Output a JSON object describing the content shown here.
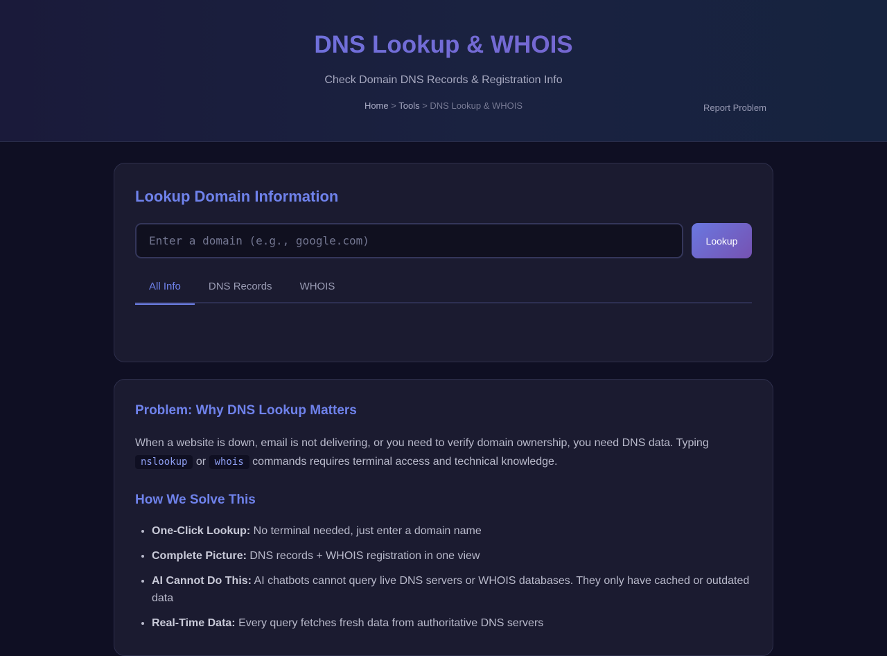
{
  "header": {
    "title": "DNS Lookup & WHOIS",
    "subtitle": "Check Domain DNS Records & Registration Info",
    "breadcrumb": {
      "home": "Home",
      "sep1": " > ",
      "tools": "Tools",
      "sep2": " > ",
      "current": "DNS Lookup & WHOIS"
    },
    "report_link": "Report Problem"
  },
  "lookup": {
    "title": "Lookup Domain Information",
    "input_placeholder": "Enter a domain (e.g., google.com)",
    "input_value": "",
    "button_label": "Lookup",
    "tabs": [
      {
        "label": "All Info",
        "active": true
      },
      {
        "label": "DNS Records",
        "active": false
      },
      {
        "label": "WHOIS",
        "active": false
      }
    ]
  },
  "info": {
    "problem_title": "Problem: Why DNS Lookup Matters",
    "problem_text_1": "When a website is down, email is not delivering, or you need to verify domain ownership, you need DNS data. Typing ",
    "code_1": "nslookup",
    "problem_text_2": " or ",
    "code_2": "whois",
    "problem_text_3": " commands requires terminal access and technical knowledge.",
    "solve_title": "How We Solve This",
    "features": [
      {
        "bold": "One-Click Lookup:",
        "text": " No terminal needed, just enter a domain name"
      },
      {
        "bold": "Complete Picture:",
        "text": " DNS records + WHOIS registration in one view"
      },
      {
        "bold": "AI Cannot Do This:",
        "text": " AI chatbots cannot query live DNS servers or WHOIS databases. They only have cached or outdated data"
      },
      {
        "bold": "Real-Time Data:",
        "text": " Every query fetches fresh data from authoritative DNS servers"
      }
    ]
  },
  "colors": {
    "background": "#0f0f23",
    "card": "#1b1b30",
    "accent": "#6f82eb",
    "accent_purple": "#7652b2"
  }
}
